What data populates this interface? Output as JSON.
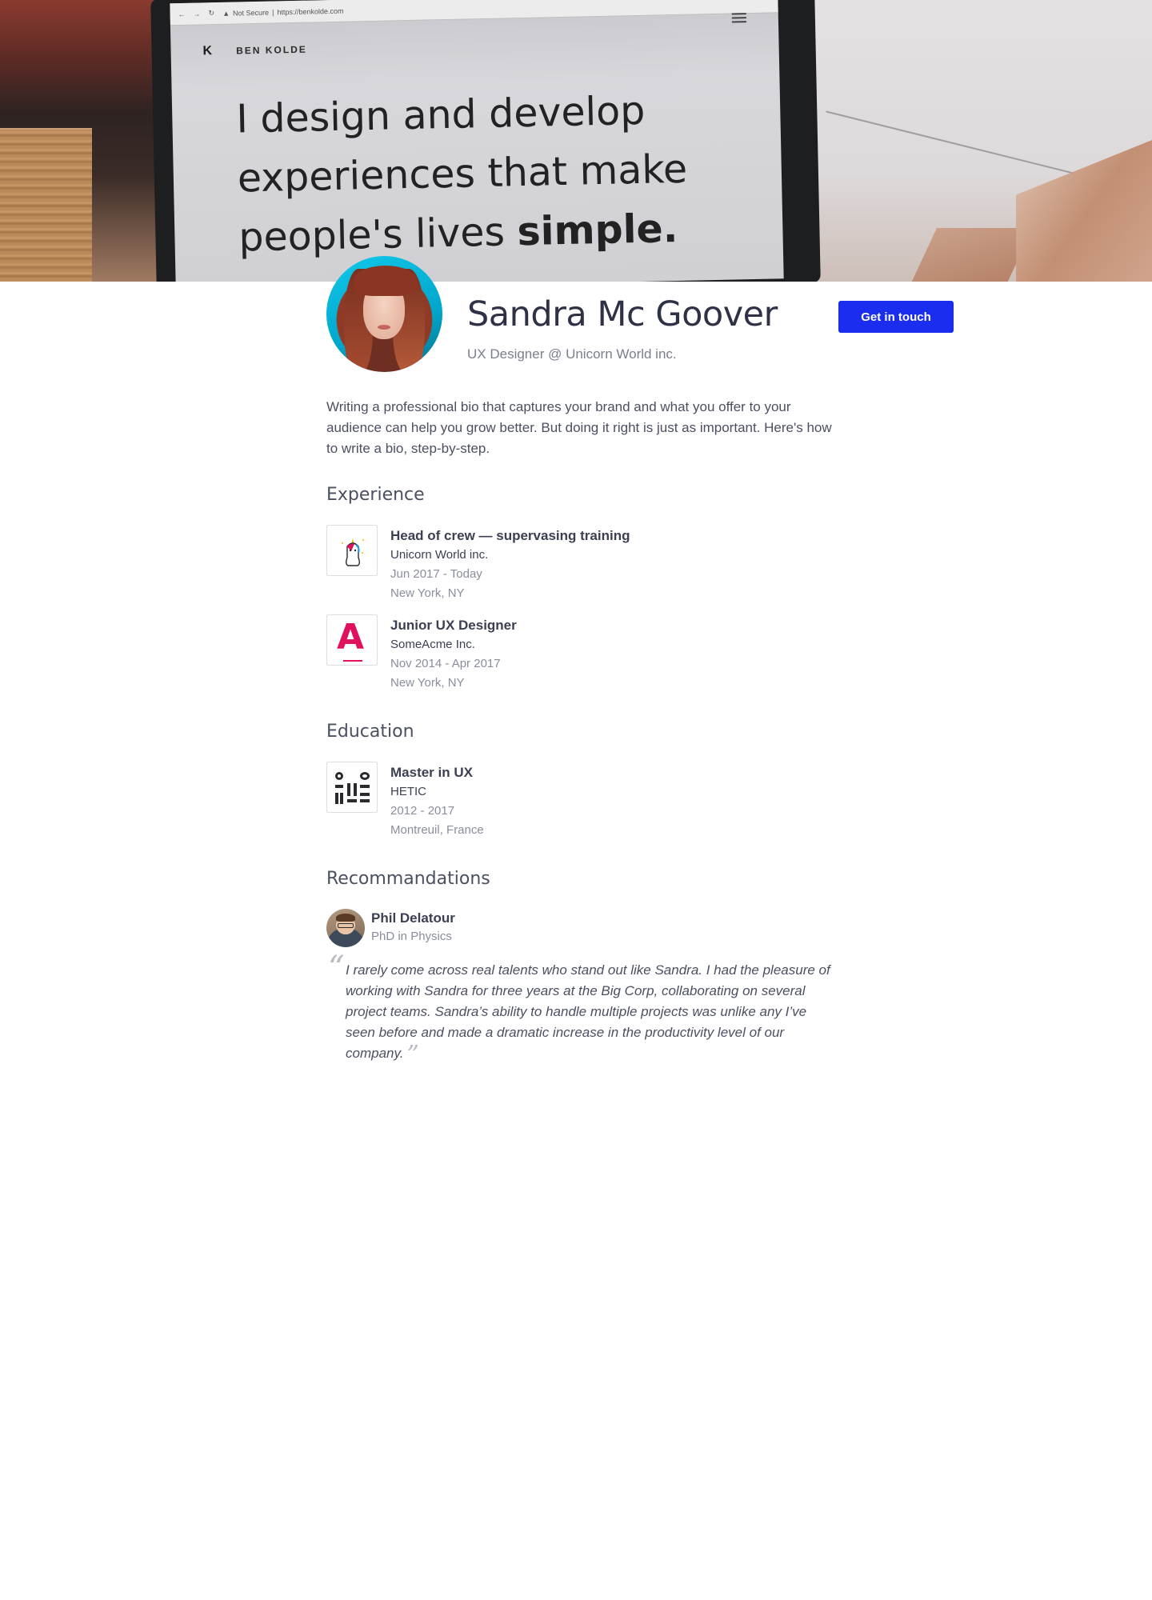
{
  "hero": {
    "browser_security": "Not Secure",
    "browser_url": "https://benkolde.com",
    "brand_name": "BEN KOLDE",
    "brand_logo": "K",
    "tagline_line1": "I design and develop",
    "tagline_line2": "experiences that make",
    "tagline_line3_regular": "people's lives ",
    "tagline_line3_bold": "simple."
  },
  "profile": {
    "name": "Sandra Mc Goover",
    "title": "UX Designer @ Unicorn World inc.",
    "cta_label": "Get in touch",
    "bio": "Writing a professional bio that captures your brand and what you offer to your audience can help you grow better. But doing it right is just as important. Here's how to write a bio, step-by-step."
  },
  "experience": {
    "heading": "Experience",
    "items": [
      {
        "role": "Head of crew — supervasing training",
        "company": "Unicorn World inc.",
        "dates": "Jun 2017 - Today",
        "location": "New York, NY",
        "logo_icon": "unicorn-logo-icon"
      },
      {
        "role": "Junior UX Designer",
        "company": "SomeAcme Inc.",
        "dates": "Nov 2014 - Apr 2017",
        "location": "New York, NY",
        "logo_icon": "acme-logo-icon"
      }
    ]
  },
  "education": {
    "heading": "Education",
    "items": [
      {
        "degree": "Master in UX",
        "school": "HETIC",
        "dates": "2012 - 2017",
        "location": "Montreuil, France",
        "logo_icon": "hetic-logo-icon"
      }
    ]
  },
  "recommendations": {
    "heading": "Recommandations",
    "items": [
      {
        "name": "Phil Delatour",
        "subtitle": "PhD in Physics",
        "quote": "I rarely come across real talents who stand out like Sandra. I had the pleasure of working with Sandra for three years at the Big Corp, collaborating on several project teams. Sandra’s ability to handle multiple projects was unlike any I’ve seen before and made a dramatic increase in the productivity level of our company."
      }
    ]
  },
  "colors": {
    "cta": "#1b2ef0",
    "acme": "#e0105e",
    "text_primary": "#3b3f52",
    "text_muted": "#8a8e9c"
  }
}
